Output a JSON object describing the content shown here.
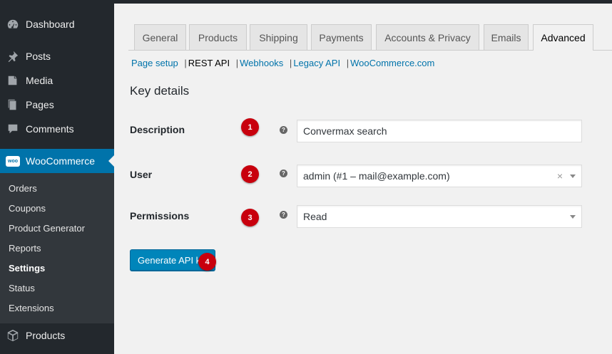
{
  "sidebar": {
    "items": [
      {
        "label": "Dashboard",
        "icon": "dashboard-icon"
      },
      {
        "label": "Posts",
        "icon": "pin-icon"
      },
      {
        "label": "Media",
        "icon": "media-icon"
      },
      {
        "label": "Pages",
        "icon": "pages-icon"
      },
      {
        "label": "Comments",
        "icon": "comment-icon"
      },
      {
        "label": "WooCommerce",
        "icon": "woo-icon",
        "badge_text": "woo"
      },
      {
        "label": "Products",
        "icon": "box-icon"
      }
    ],
    "woocommerce_submenu": [
      {
        "label": "Orders"
      },
      {
        "label": "Coupons"
      },
      {
        "label": "Product Generator"
      },
      {
        "label": "Reports"
      },
      {
        "label": "Settings"
      },
      {
        "label": "Status"
      },
      {
        "label": "Extensions"
      }
    ]
  },
  "tabs": [
    {
      "label": "General"
    },
    {
      "label": "Products"
    },
    {
      "label": "Shipping"
    },
    {
      "label": "Payments"
    },
    {
      "label": "Accounts & Privacy"
    },
    {
      "label": "Emails"
    },
    {
      "label": "Advanced"
    }
  ],
  "subnav": {
    "items": [
      "Page setup",
      "REST API",
      "Webhooks",
      "Legacy API",
      "WooCommerce.com"
    ],
    "separator": "|"
  },
  "section": {
    "heading": "Key details"
  },
  "form": {
    "description": {
      "label": "Description",
      "value": "Convermax search",
      "help": "?",
      "step": "1"
    },
    "user": {
      "label": "User",
      "value": "admin (#1 – mail@example.com)",
      "help": "?",
      "step": "2",
      "clear": "×"
    },
    "permissions": {
      "label": "Permissions",
      "value": "Read",
      "help": "?",
      "step": "3"
    }
  },
  "generate_button": {
    "label": "Generate API key",
    "step": "4"
  },
  "colors": {
    "sidebar_bg": "#23282d",
    "submenu_bg": "#32373c",
    "active_menu": "#0073aa",
    "link": "#0073aa",
    "primary_button": "#0085ba",
    "step_badge": "#c8000d"
  }
}
